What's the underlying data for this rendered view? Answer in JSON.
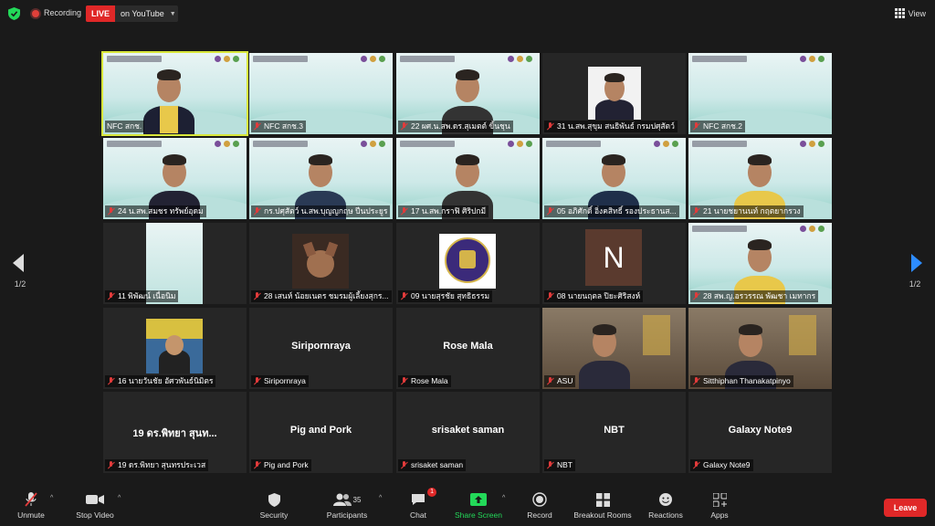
{
  "topbar": {
    "recording_label": "Recording",
    "live_label": "LIVE",
    "live_platform": "on YouTube",
    "view_label": "View"
  },
  "pager": {
    "left": "1/2",
    "right": "1/2"
  },
  "tiles": [
    {
      "name": "NFC สกช.",
      "type": "speaker"
    },
    {
      "name": "NFC สกช.3",
      "type": "slide"
    },
    {
      "name": "22 ผศ.น.สพ.ดร.สุเมตต์ ขิ้นชุน",
      "type": "person"
    },
    {
      "name": "31 น.สพ.สุขุม สนธิพันธ์ กรมปศุสัตว์",
      "type": "portrait"
    },
    {
      "name": "NFC สกช.2",
      "type": "slide"
    },
    {
      "name": "24 น.สพ.สมชร ทรัพย์อุดม",
      "type": "person"
    },
    {
      "name": "กร.ปศุสัตว์ น.สพ.บุญญกฤษ ปีนประยูร",
      "type": "person"
    },
    {
      "name": "17 น.สพ.กราฟิ ศิริปกมี",
      "type": "person"
    },
    {
      "name": "05 อภิศักดิ์ อิ่งคสิทธิ์ รองประธานส...",
      "type": "person"
    },
    {
      "name": "21 นายชยานนท์ กฤตยากรวง",
      "type": "person"
    },
    {
      "name": "11 พิพัฒน์ เนื่อนิม",
      "type": "slide-narrow"
    },
    {
      "name": "28 เสนห์ น้อยเนตร ชมรมผู้เลี้ยงสุกร...",
      "type": "dog"
    },
    {
      "name": "09 นายสุรชัย สุทธิธรรม",
      "type": "logo"
    },
    {
      "name": "08 นายนฤตล ปิยะศิริสงห์",
      "type": "avatar",
      "initial": "N"
    },
    {
      "name": "28 สพ.ญ.อรวรรณ พัฒชา เมทากร",
      "type": "person-slide"
    },
    {
      "name": "16 นายวันชัย อัศวพันธ์นิมิตร",
      "type": "photo-cam"
    },
    {
      "name": "Siripornraya",
      "type": "name-only",
      "display": "Siripornraya"
    },
    {
      "name": "Rose Mala",
      "type": "name-only",
      "display": "Rose Mala"
    },
    {
      "name": "ASU",
      "type": "person-room"
    },
    {
      "name": "Sitthiphan Thanakatpinyo",
      "type": "person-room"
    },
    {
      "name": "19 ดร.พิทยา สุนทรประเวส",
      "type": "name-only",
      "display": "19 ดร.พิทยา สุนท..."
    },
    {
      "name": "Pig and Pork",
      "type": "name-only",
      "display": "Pig and Pork"
    },
    {
      "name": "srisaket saman",
      "type": "name-only",
      "display": "srisaket saman"
    },
    {
      "name": "NBT",
      "type": "name-only",
      "display": "NBT"
    },
    {
      "name": "Galaxy Note9",
      "type": "name-only",
      "display": "Galaxy Note9"
    }
  ],
  "toolbar": {
    "unmute": "Unmute",
    "stop_video": "Stop Video",
    "security": "Security",
    "participants": "Participants",
    "participants_count": "35",
    "chat": "Chat",
    "chat_badge": "1",
    "share_screen": "Share Screen",
    "record": "Record",
    "breakout": "Breakout Rooms",
    "reactions": "Reactions",
    "apps": "Apps",
    "leave": "Leave"
  },
  "colors": {
    "share_green": "#23d959",
    "leave_red": "#e02828",
    "active_speaker": "#d8e63a",
    "nav_arrow": "#2d8cff"
  }
}
